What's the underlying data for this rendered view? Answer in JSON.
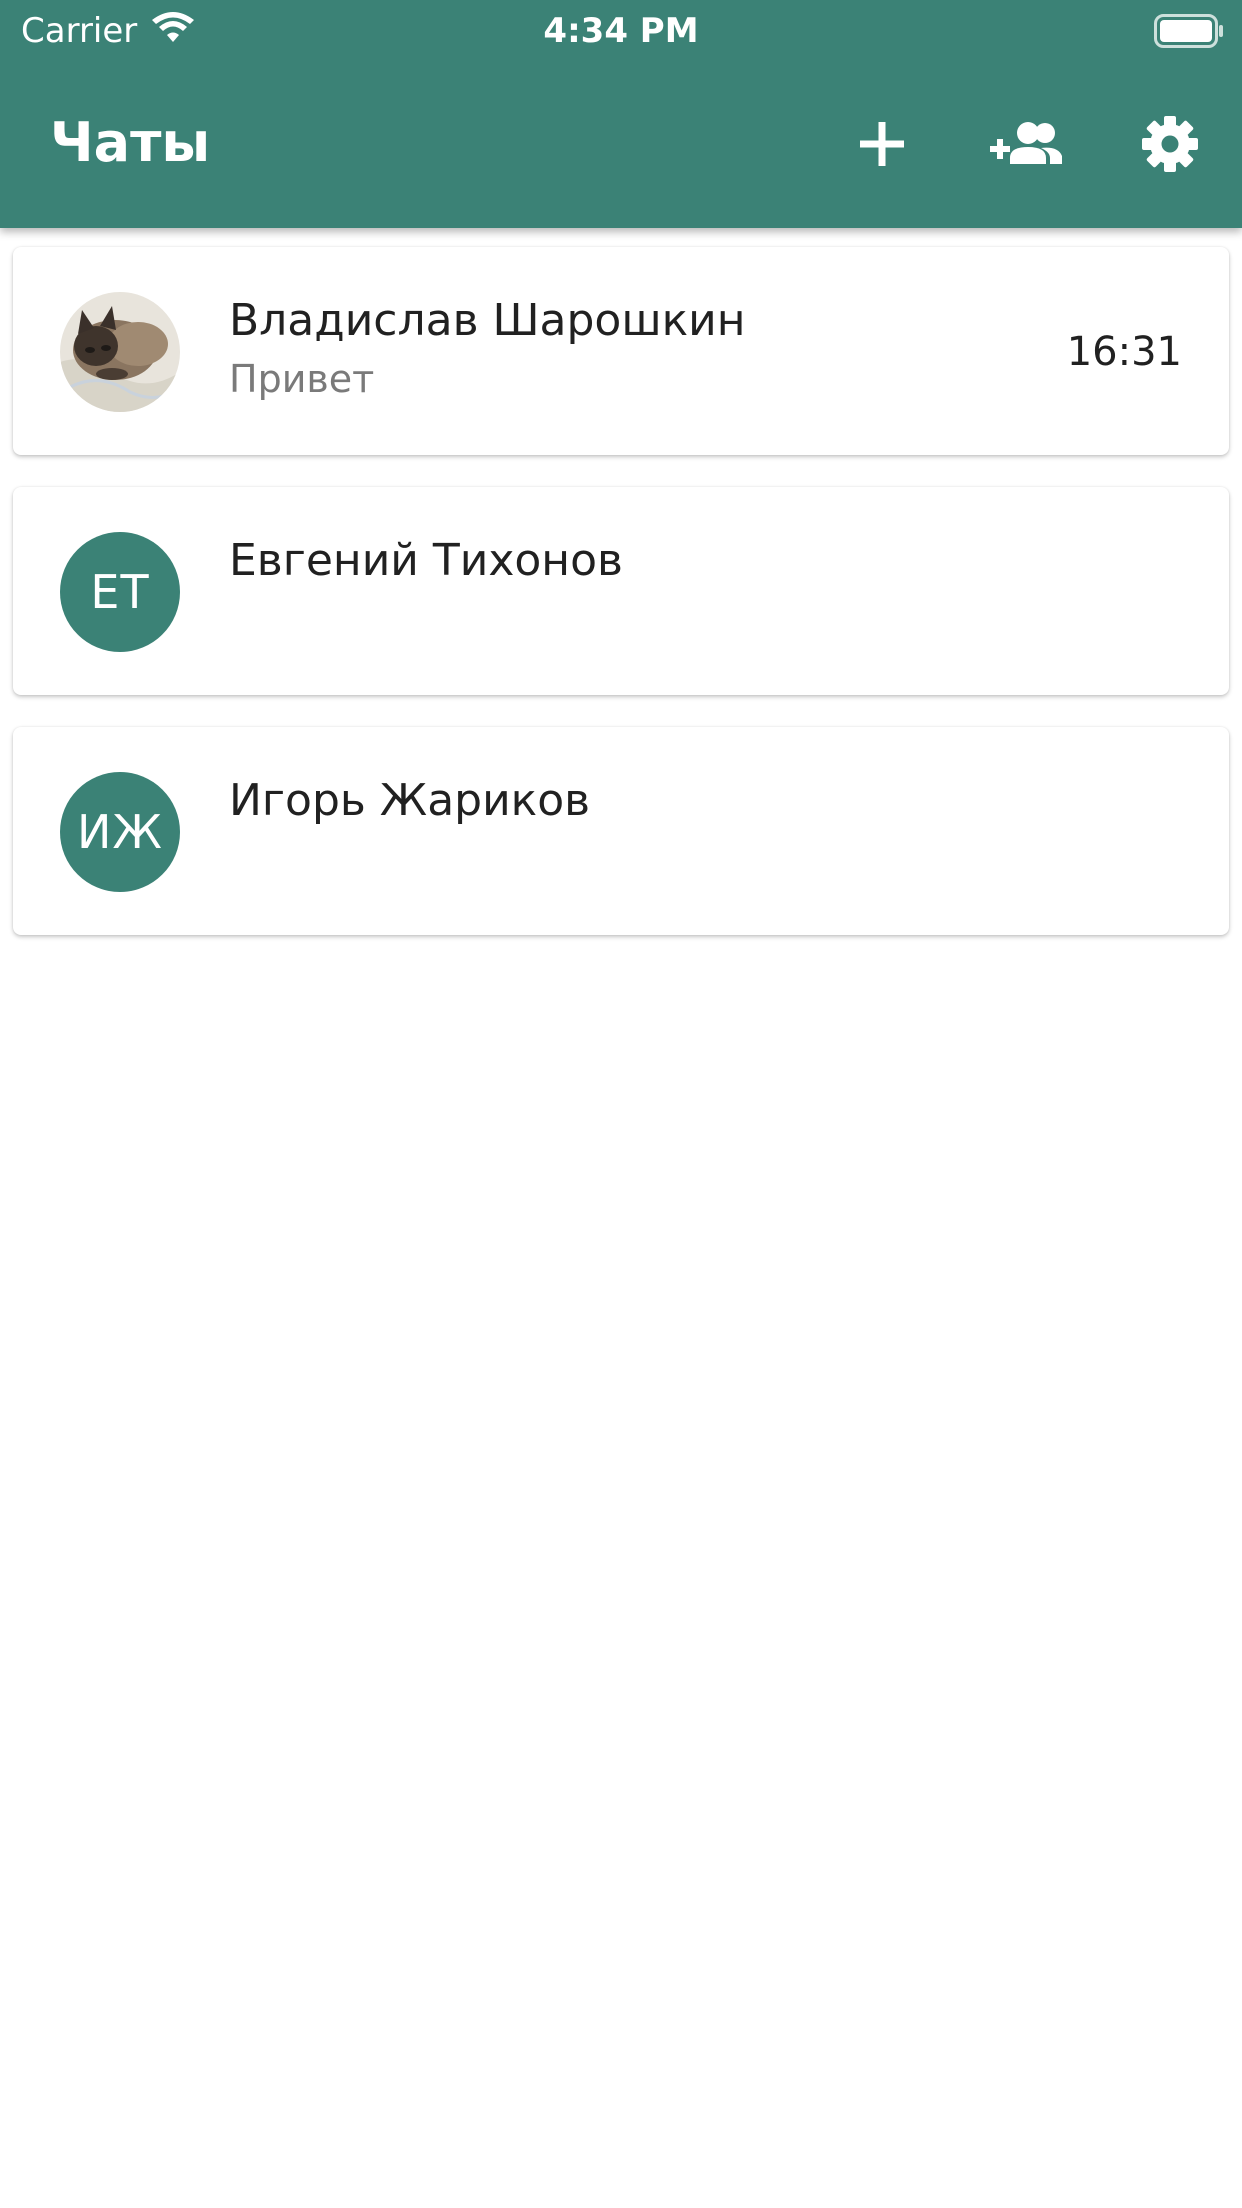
{
  "status_bar": {
    "carrier": "Carrier",
    "time": "4:34 PM",
    "wifi_icon": "wifi-icon",
    "battery_icon": "battery-full-icon"
  },
  "app_bar": {
    "title": "Чаты",
    "background_color": "#3b8276",
    "actions": [
      {
        "icon": "plus-icon",
        "label": "new chat"
      },
      {
        "icon": "add-contact-icon",
        "label": "add contact"
      },
      {
        "icon": "gear-icon",
        "label": "settings"
      }
    ]
  },
  "chats": [
    {
      "name": "Владислав Шарошкин",
      "last_message": "Привет",
      "time": "16:31",
      "avatar": "photo"
    },
    {
      "name": "Евгений Тихонов",
      "last_message": "",
      "time": "",
      "avatar_initials": "ЕТ"
    },
    {
      "name": "Игорь Жариков",
      "last_message": "",
      "time": "",
      "avatar_initials": "ИЖ"
    }
  ]
}
